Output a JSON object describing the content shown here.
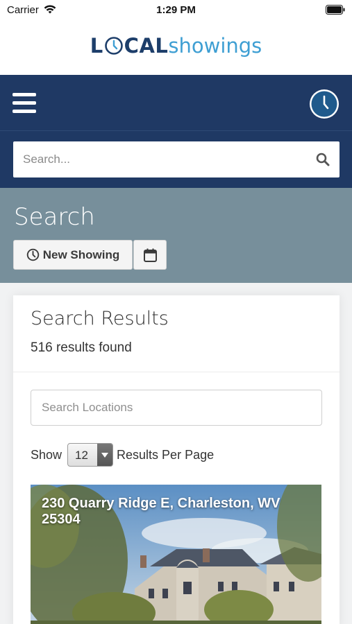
{
  "status_bar": {
    "carrier": "Carrier",
    "time": "1:29 PM"
  },
  "logo": {
    "part_l": "L",
    "part_cal": "CAL",
    "part_showings": "showings"
  },
  "icons": {
    "wifi": "wifi-icon",
    "battery": "battery-icon",
    "menu": "hamburger-menu-icon",
    "clock": "clock-icon",
    "search": "search-icon",
    "calendar": "calendar-icon"
  },
  "colors": {
    "brand_navy": "#1f3964",
    "brand_blue": "#3f9fd3",
    "header_slate": "#778f9b"
  },
  "top_search": {
    "placeholder": "Search..."
  },
  "page": {
    "title": "Search"
  },
  "actions": {
    "new_showing_label": "New Showing"
  },
  "results": {
    "title": "Search Results",
    "count_text": "516 results found",
    "locations_placeholder": "Search Locations",
    "show_label": "Show",
    "per_page_value": "12",
    "per_page_suffix": "Results Per Page"
  },
  "listings": [
    {
      "address": "230 Quarry Ridge E, Charleston, WV 25304"
    }
  ]
}
